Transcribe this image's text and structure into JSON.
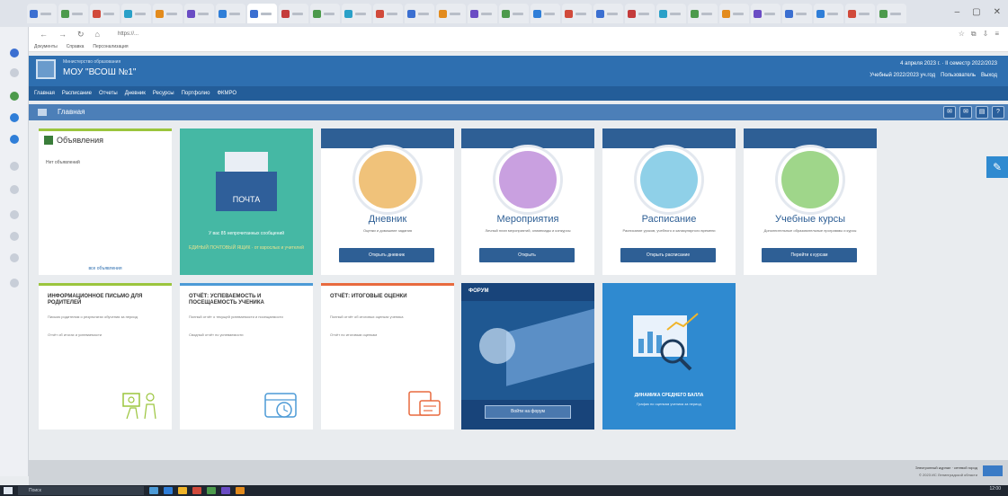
{
  "browser": {
    "address": "https://...",
    "bookmarks": [
      "Документы",
      "Справка",
      "Персонализация"
    ],
    "tab_colors": [
      "#3b6fd1",
      "#4c9a4c",
      "#d14a3b",
      "#2aa0c8",
      "#e38b1d",
      "#6a4cc4",
      "#2f7ed8",
      "#3b6fd1",
      "#c43b3b",
      "#4c9a4c",
      "#2aa0c8",
      "#d14a3b",
      "#3b6fd1",
      "#e38b1d",
      "#6a4cc4",
      "#4c9a4c",
      "#2f7ed8",
      "#d14a3b",
      "#3b6fd1",
      "#c43b3b",
      "#2aa0c8",
      "#4c9a4c",
      "#e38b1d",
      "#6a4cc4",
      "#3b6fd1",
      "#2f7ed8",
      "#d14a3b",
      "#4c9a4c"
    ]
  },
  "header": {
    "school_subtitle": "Министерство образования",
    "school_name": "МОУ \"ВСОШ №1\"",
    "date_line": "4 апреля 2023 г. · II семестр 2022/2023",
    "year_line": "Учебный 2022/2023 уч.год",
    "user": "Пользователь",
    "exit": "Выход"
  },
  "menu": [
    "Главная",
    "Расписание",
    "Отчеты",
    "Дневник",
    "Ресурсы",
    "Портфолио",
    "ФКМРО"
  ],
  "breadcrumb": {
    "title": "Главная"
  },
  "news": {
    "title": "Объявления",
    "empty": "Нет объявлений",
    "link": "все объявления"
  },
  "mail": {
    "label": "ПОЧТА",
    "line1": "У вас 85 непрочитанных сообщений",
    "line2": "ЕДИНЫЙ ПОЧТОВЫЙ ЯЩИК · от взрослых и учителей"
  },
  "services": [
    {
      "title": "Дневник",
      "desc": "Оценки и домашние задания",
      "button": "Открыть дневник",
      "color": "#f0c27a"
    },
    {
      "title": "Мероприятия",
      "desc": "Личный план мероприятий, олимпиады и конкурсы",
      "button": "Открыть",
      "color": "#c9a0e0"
    },
    {
      "title": "Расписание",
      "desc": "Расписание уроков, учебного и каникулярного времени",
      "button": "Открыть расписание",
      "color": "#8fd0e8"
    },
    {
      "title": "Учебные курсы",
      "desc": "Дополнительные образовательные программы и курсы",
      "button": "Перейти к курсам",
      "color": "#9fd68a"
    }
  ],
  "reports": [
    {
      "title": "ИНФОРМАЦИОННОЕ ПИСЬМО ДЛЯ РОДИТЕЛЕЙ",
      "p1": "Письмо родителям о результатах обучения за период",
      "p2": "Отчёт об итогах и успеваемости",
      "color": "#9bc53d"
    },
    {
      "title": "ОТЧЁТ: УСПЕВАЕМОСТЬ И ПОСЕЩАЕМОСТЬ УЧЕНИКА",
      "p1": "Полный отчёт о текущей успеваемости и посещаемости",
      "p2": "Сводный отчёт по успеваемости",
      "color": "#4c9ad6"
    },
    {
      "title": "ОТЧЁТ: ИТОГОВЫЕ ОЦЕНКИ",
      "p1": "Полный отчёт об итоговых оценках ученика",
      "p2": "Отчёт по итоговым оценкам",
      "color": "#e86a3e"
    }
  ],
  "forum": {
    "label": "ФОРУМ",
    "button": "Войти на форум"
  },
  "dynamics": {
    "title": "ДИНАМИКА СРЕДНЕГО БАЛЛА",
    "subtitle": "График по оценкам ученика за период"
  },
  "footer": {
    "line1": "Электронный журнал · сетевой город",
    "line2": "© 2023 ИС Ленинградской области"
  },
  "taskbar": {
    "search": "Поиск",
    "clock": "12:00"
  }
}
